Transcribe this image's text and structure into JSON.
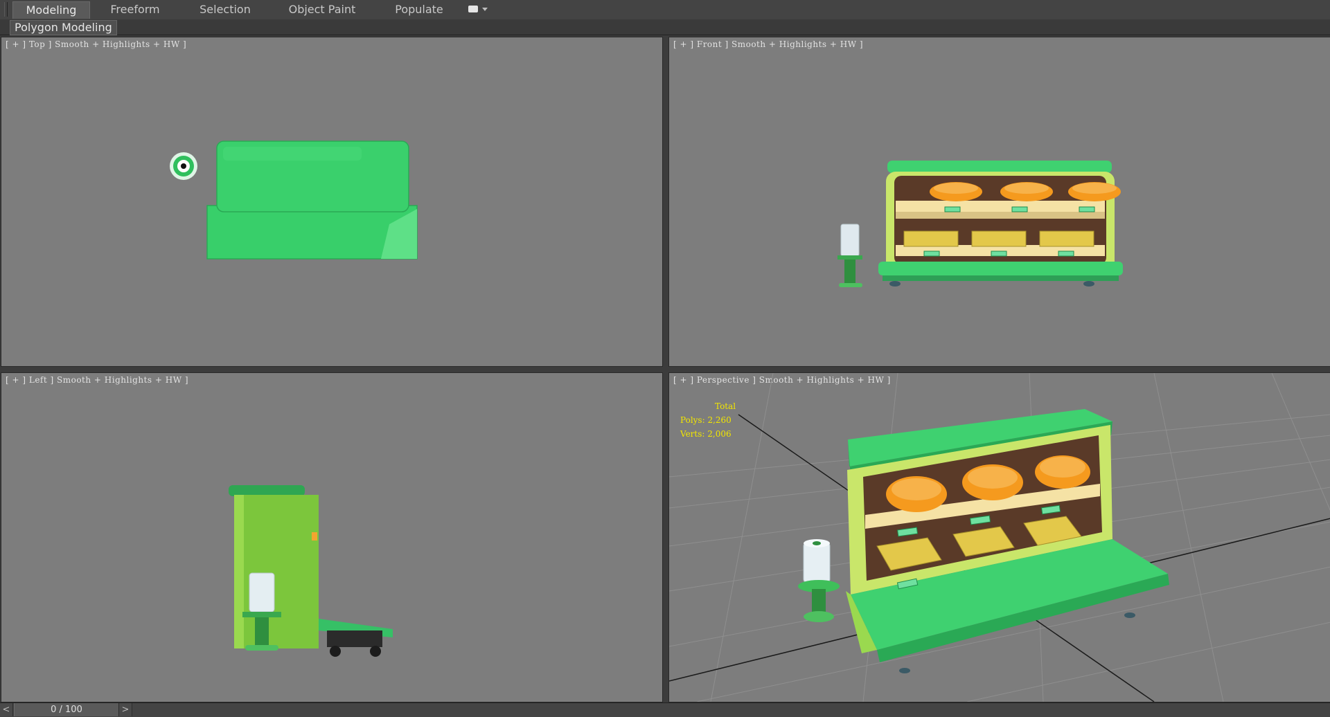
{
  "ribbon": {
    "tabs": [
      {
        "label": "Modeling",
        "active": true
      },
      {
        "label": "Freeform",
        "active": false
      },
      {
        "label": "Selection",
        "active": false
      },
      {
        "label": "Object Paint",
        "active": false
      },
      {
        "label": "Populate",
        "active": false
      }
    ],
    "options_icon": "ribbon-options-icon",
    "panel_label": "Polygon Modeling"
  },
  "viewports": {
    "top": {
      "label": "[ + ] Top ] Smooth + Highlights + HW ]"
    },
    "front": {
      "label": "[ + ] Front ] Smooth + Highlights + HW ]"
    },
    "left": {
      "label": "[ + ] Left ] Smooth + Highlights + HW ]"
    },
    "perspective": {
      "label": "[ + ] Perspective ] Smooth + Highlights + HW ]"
    }
  },
  "stats": {
    "title": "Total",
    "polys": "Polys: 2,260",
    "verts": "Verts: 2,006"
  },
  "timeline": {
    "frame": "0 / 100",
    "prev": "<",
    "next": ">"
  },
  "colors": {
    "viewport_bg": "#7d7d7d",
    "model_green": "#3fd170",
    "stats_yellow": "#f2e600"
  }
}
